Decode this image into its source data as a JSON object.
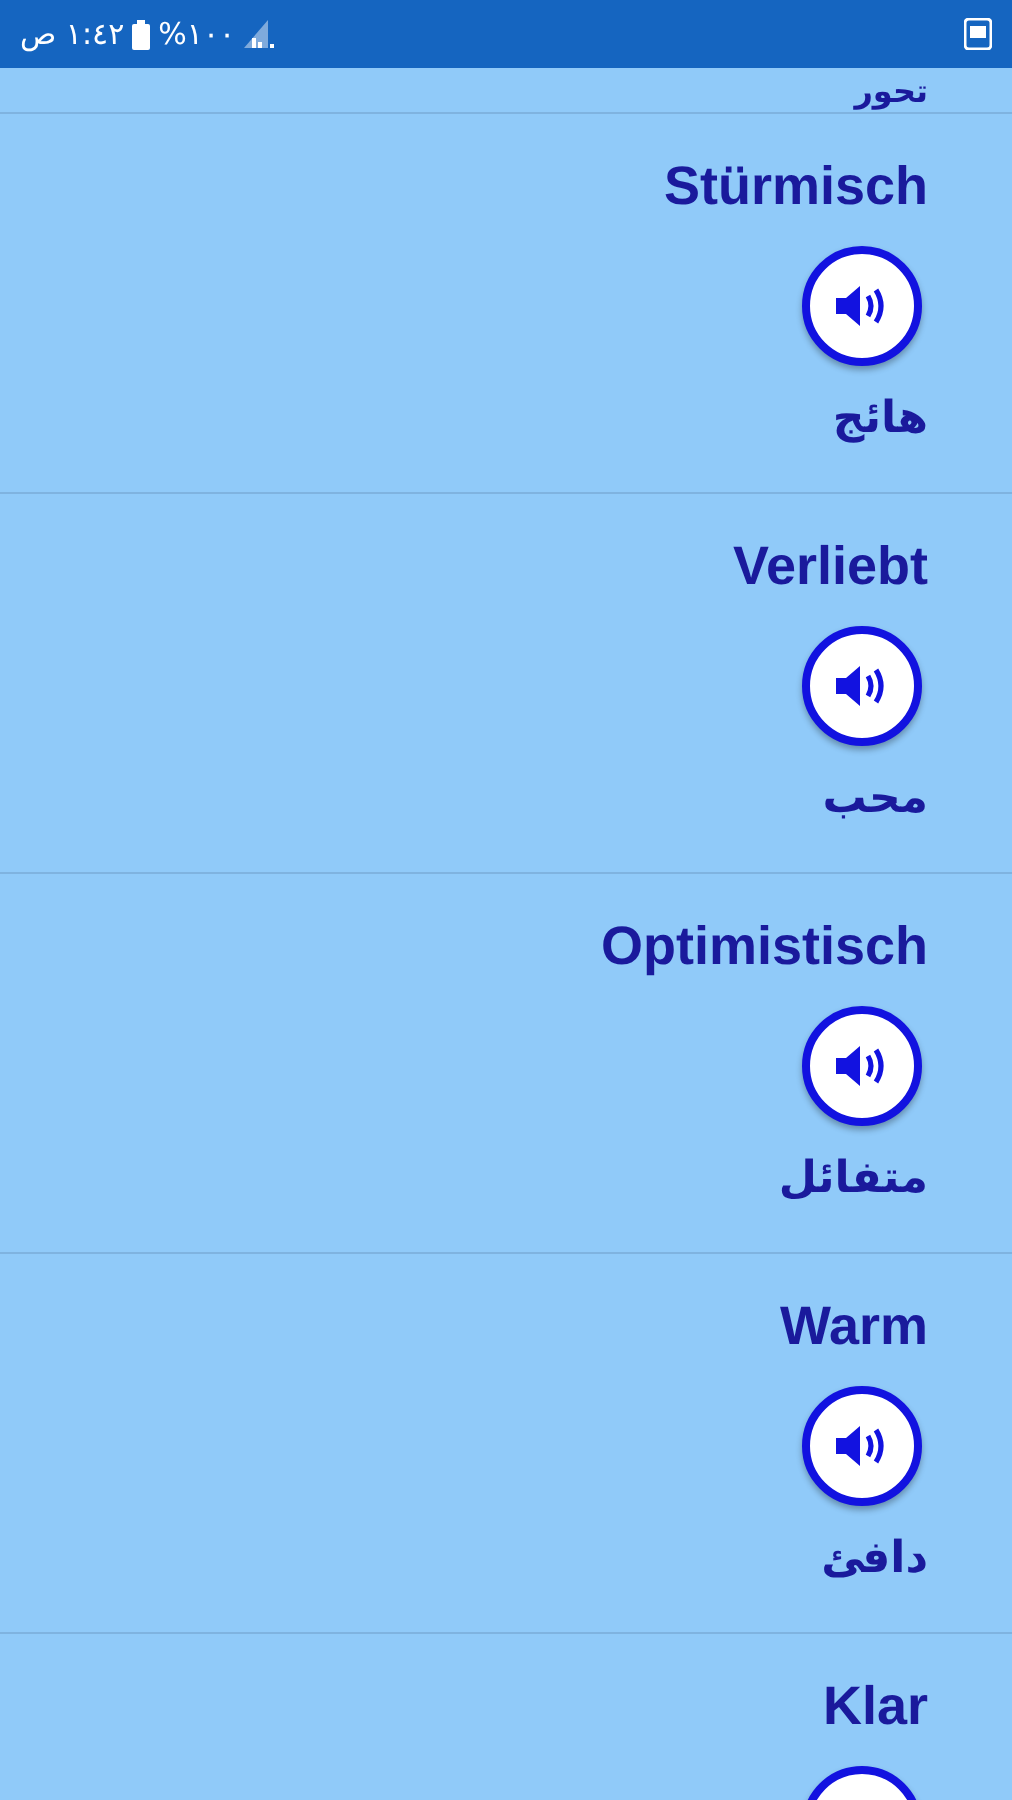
{
  "status_bar": {
    "time": "١:٤٢ ص",
    "battery": "%١٠٠"
  },
  "partial_entry": {
    "translation": "تحور"
  },
  "entries": [
    {
      "word": "Stürmisch",
      "translation": "هائج"
    },
    {
      "word": "Verliebt",
      "translation": "محب"
    },
    {
      "word": "Optimistisch",
      "translation": "متفائل"
    },
    {
      "word": "Warm",
      "translation": "دافئ"
    },
    {
      "word": "Klar"
    }
  ]
}
